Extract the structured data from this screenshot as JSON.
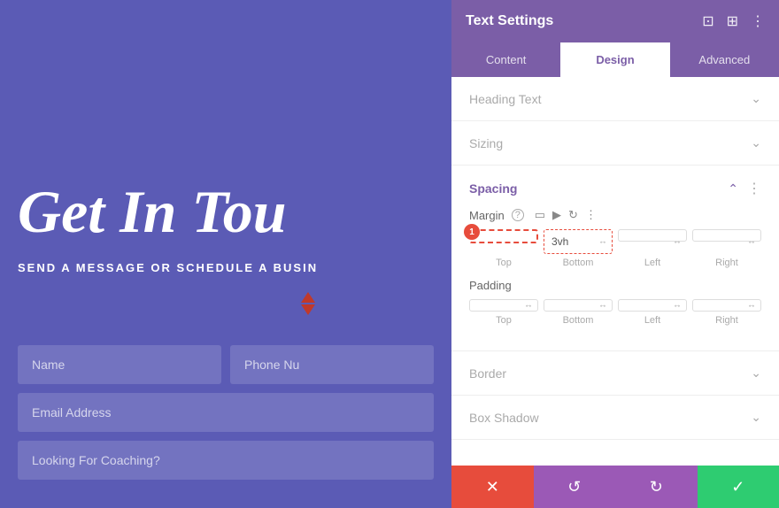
{
  "preview": {
    "heading": "Get In Tou",
    "subheading": "SEND A MESSAGE OR SCHEDULE A BUSIN",
    "form": {
      "fields": [
        {
          "placeholder": "Name",
          "row": 1
        },
        {
          "placeholder": "Phone Nu",
          "row": 1
        },
        {
          "placeholder": "Email Address",
          "row": 2
        },
        {
          "placeholder": "Looking For Coaching?",
          "row": 3
        }
      ]
    }
  },
  "settings": {
    "title": "Text Settings",
    "header_icons": [
      "resize",
      "columns",
      "more"
    ],
    "tabs": [
      {
        "label": "Content",
        "active": false
      },
      {
        "label": "Design",
        "active": true
      },
      {
        "label": "Advanced",
        "active": false
      }
    ],
    "sections": [
      {
        "label": "Heading Text",
        "expanded": false
      },
      {
        "label": "Sizing",
        "expanded": false
      },
      {
        "label": "Spacing",
        "expanded": true,
        "margin": {
          "label": "Margin",
          "top": {
            "value": "",
            "placeholder": ""
          },
          "bottom": {
            "value": "3vh",
            "placeholder": "3vh"
          },
          "left": {
            "value": "",
            "placeholder": ""
          },
          "right": {
            "value": "",
            "placeholder": ""
          },
          "field_labels": [
            "Top",
            "Bottom",
            "Left",
            "Right"
          ],
          "badge": "1"
        },
        "padding": {
          "label": "Padding",
          "top": {
            "value": "",
            "placeholder": ""
          },
          "bottom": {
            "value": "",
            "placeholder": ""
          },
          "left": {
            "value": "",
            "placeholder": ""
          },
          "right": {
            "value": "",
            "placeholder": ""
          },
          "field_labels": [
            "Top",
            "Bottom",
            "Left",
            "Right"
          ]
        }
      },
      {
        "label": "Border",
        "expanded": false
      },
      {
        "label": "Box Shadow",
        "expanded": false
      }
    ],
    "spacing_toolbar_icons": [
      "?",
      "device",
      "cursor",
      "reset",
      "more"
    ],
    "bottom_bar": {
      "cancel": "✕",
      "reset": "↺",
      "redo": "↻",
      "save": "✓"
    }
  }
}
